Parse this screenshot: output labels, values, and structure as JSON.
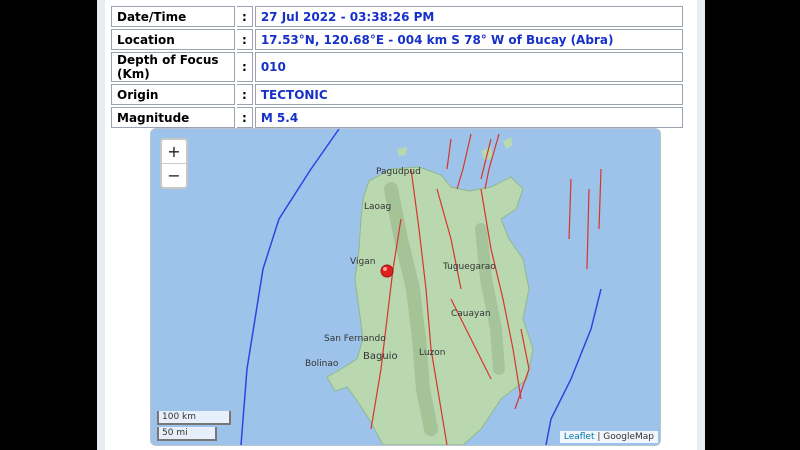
{
  "info": {
    "rows": [
      {
        "label": "Date/Time",
        "value": "27 Jul 2022 - 03:38:26 PM"
      },
      {
        "label": "Location",
        "value": "17.53°N, 120.68°E - 004 km S 78° W of Bucay (Abra)"
      },
      {
        "label": "Depth of Focus (Km)",
        "value": "010"
      },
      {
        "label": "Origin",
        "value": "TECTONIC"
      },
      {
        "label": "Magnitude",
        "value": "M 5.4"
      }
    ],
    "separator": ":"
  },
  "map": {
    "zoom_in": "+",
    "zoom_out": "−",
    "scale_km": "100 km",
    "scale_mi": "50 mi",
    "attribution_link": "Leaflet",
    "attribution_sep": " | ",
    "attribution_text": "GoogleMap",
    "places": [
      "Pagudpud",
      "Laoag",
      "Vigan",
      "Tuguegarao",
      "Cauayan",
      "San Fernando",
      "Baguio",
      "Luzon",
      "Bolinao"
    ],
    "colors": {
      "water": "#9ec3ea",
      "land": "#b9d8b0",
      "faults": "#d9342b",
      "trench": "#2b46e0",
      "value_text": "#1730c8"
    }
  }
}
